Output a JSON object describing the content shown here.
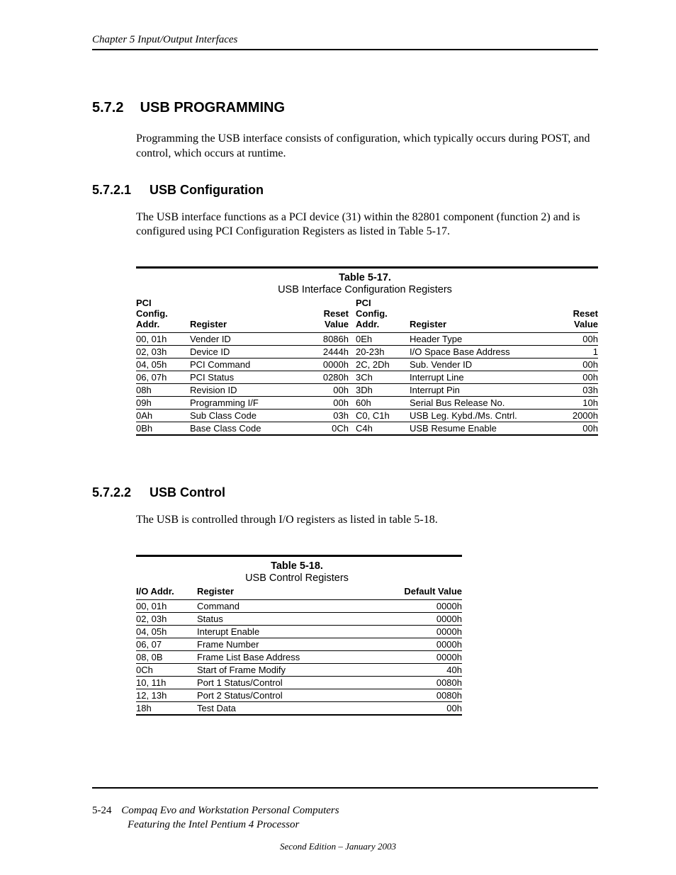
{
  "header": {
    "chapter_line": "Chapter 5  Input/Output Interfaces"
  },
  "sec572": {
    "num": "5.7.2",
    "title": "USB PROGRAMMING",
    "para": "Programming the USB interface consists of configuration, which typically occurs during POST, and control, which occurs at runtime."
  },
  "sec5721": {
    "num": "5.7.2.1",
    "title": "USB Configuration",
    "para": "The USB interface functions as a PCI device (31) within the 82801 component (function 2) and is configured using PCI Configuration Registers as listed in Table 5-17."
  },
  "table17": {
    "label": "Table 5-17.",
    "caption": "USB Interface Configuration Registers",
    "hdr": {
      "a": "PCI\nConfig.\nAddr.",
      "b": "Register",
      "c": "Reset\nValue",
      "d": "PCI\nConfig.\nAddr.",
      "e": "Register",
      "f": "Reset\nValue"
    },
    "rows": [
      {
        "a": "00, 01h",
        "b": "Vender ID",
        "c": "8086h",
        "d": "0Eh",
        "e": "Header Type",
        "f": "00h"
      },
      {
        "a": "02, 03h",
        "b": "Device ID",
        "c": "2444h",
        "d": "20-23h",
        "e": "I/O Space Base Address",
        "f": "1"
      },
      {
        "a": "04, 05h",
        "b": "PCI Command",
        "c": "0000h",
        "d": "2C, 2Dh",
        "e": "Sub. Vender ID",
        "f": "00h"
      },
      {
        "a": "06, 07h",
        "b": "PCI Status",
        "c": "0280h",
        "d": "3Ch",
        "e": "Interrupt Line",
        "f": "00h"
      },
      {
        "a": "08h",
        "b": "Revision ID",
        "c": "00h",
        "d": "3Dh",
        "e": "Interrupt Pin",
        "f": "03h"
      },
      {
        "a": "09h",
        "b": "Programming I/F",
        "c": "00h",
        "d": "60h",
        "e": "Serial Bus Release No.",
        "f": "10h"
      },
      {
        "a": "0Ah",
        "b": "Sub Class Code",
        "c": "03h",
        "d": "C0, C1h",
        "e": "USB Leg. Kybd./Ms. Cntrl.",
        "f": "2000h"
      },
      {
        "a": "0Bh",
        "b": "Base Class Code",
        "c": "0Ch",
        "d": "C4h",
        "e": "USB Resume Enable",
        "f": "00h"
      }
    ]
  },
  "sec5722": {
    "num": "5.7.2.2",
    "title": "USB Control",
    "para": "The USB is controlled through I/O registers as listed in table 5-18."
  },
  "table18": {
    "label": "Table 5-18.",
    "caption": "USB Control Registers",
    "hdr": {
      "a": "I/O Addr.",
      "b": "Register",
      "c": "Default Value"
    },
    "rows": [
      {
        "a": "00, 01h",
        "b": "Command",
        "c": "0000h"
      },
      {
        "a": "02, 03h",
        "b": "Status",
        "c": "0000h"
      },
      {
        "a": "04, 05h",
        "b": "Interupt Enable",
        "c": "0000h"
      },
      {
        "a": "06, 07",
        "b": "Frame Number",
        "c": "0000h"
      },
      {
        "a": "08, 0B",
        "b": "Frame List Base Address",
        "c": "0000h"
      },
      {
        "a": "0Ch",
        "b": "Start of Frame Modify",
        "c": "40h"
      },
      {
        "a": "10, 11h",
        "b": "Port 1 Status/Control",
        "c": "0080h"
      },
      {
        "a": "12, 13h",
        "b": "Port 2 Status/Control",
        "c": "0080h"
      },
      {
        "a": "18h",
        "b": "Test Data",
        "c": "00h"
      }
    ]
  },
  "footer": {
    "page_num": "5-24",
    "line1": "Compaq Evo and Workstation Personal Computers",
    "line2": "Featuring the Intel Pentium 4 Processor",
    "edition": "Second Edition – January 2003"
  }
}
